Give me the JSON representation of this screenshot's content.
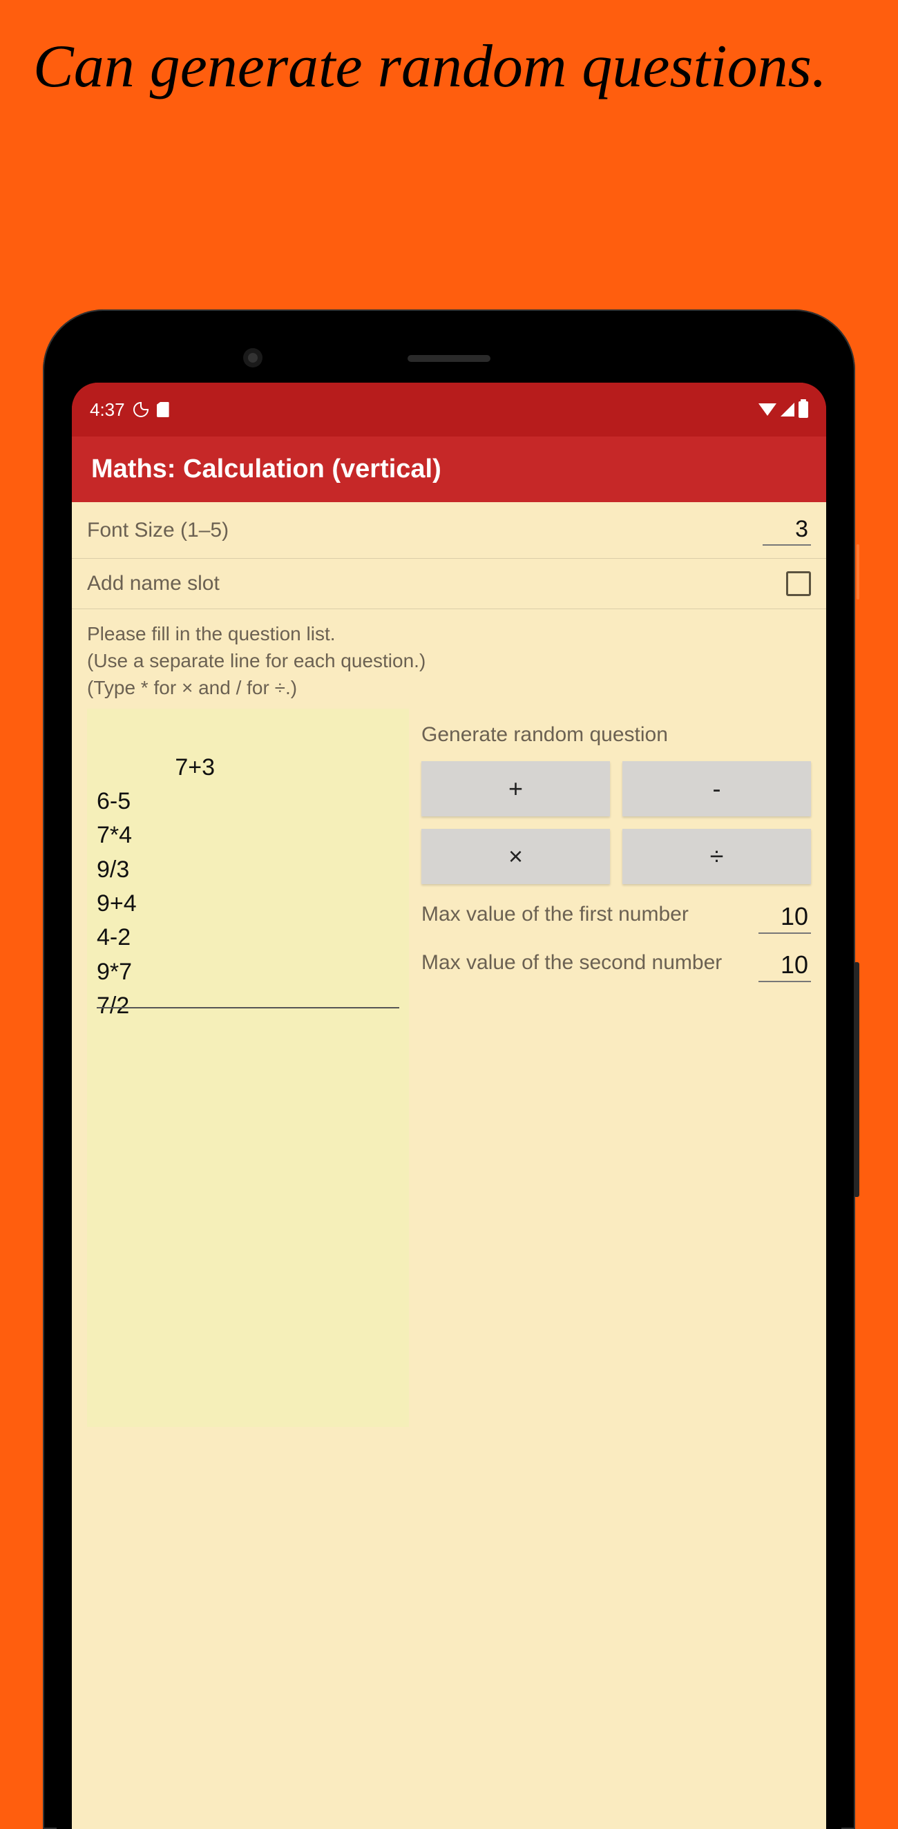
{
  "headline": "Can generate random questions.",
  "status": {
    "time": "4:37"
  },
  "app_title": "Maths: Calculation (vertical)",
  "font_size": {
    "label": "Font Size (1–5)",
    "value": "3"
  },
  "name_slot": {
    "label": "Add name slot"
  },
  "instructions": "Please fill in the question list.\n(Use a separate line for each question.)\n(Type * for × and / for ÷.)",
  "questions_text": "7+3\n6-5\n7*4\n9/3\n9+4\n4-2\n9*7\n7/2",
  "gen": {
    "title": "Generate random question",
    "ops": {
      "plus": "+",
      "minus": "-",
      "times": "×",
      "divide": "÷"
    },
    "max1": {
      "label": "Max value of the first number",
      "value": "10"
    },
    "max2": {
      "label": "Max value of the second number",
      "value": "10"
    }
  }
}
